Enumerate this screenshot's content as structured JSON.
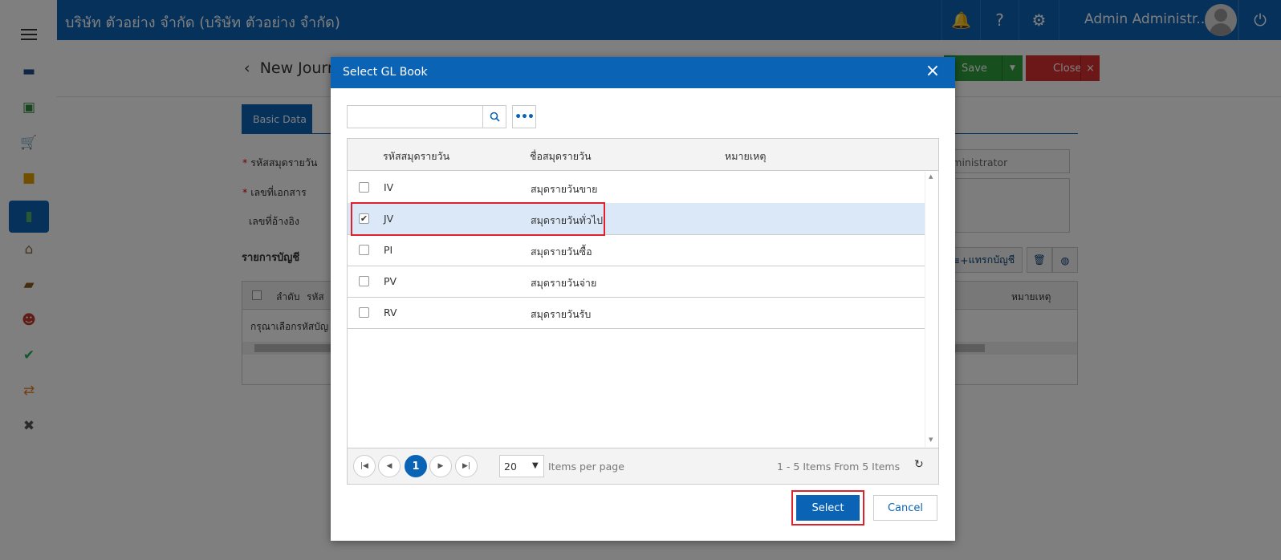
{
  "topbar": {
    "company": "บริษัท ตัวอย่าง จำกัด (บริษัท ตัวอย่าง จำกัด)",
    "user": "Admin Administr..."
  },
  "page": {
    "title": "New Journ",
    "save_label": "Save",
    "close_label": "Close",
    "close_x": "×",
    "tab_basic": "Basic Data",
    "label_journal_code": "รหัสสมุดรายวัน",
    "label_doc_no": "เลขที่เอกสาร",
    "label_ref_no": "เลขที่อ้างอิง",
    "req_mark": "*",
    "creator_value": "Administrator",
    "section_accounts": "รายการบัญชี",
    "insert_account_label": "แทรกบัญชี",
    "grid_col_seq": "ลำดับ",
    "grid_col_code": "รหัส",
    "grid_col_note": "หมายเหตุ",
    "grid_empty": "กรุณาเลือกรหัสบัญ"
  },
  "dialog": {
    "title": "Select GL Book",
    "search": {
      "value": "",
      "placeholder": ""
    },
    "columns": {
      "code": "รหัสสมุดรายวัน",
      "name": "ชื่อสมุดรายวัน",
      "note": "หมายเหตุ"
    },
    "rows": [
      {
        "code": "IV",
        "name": "สมุดรายวันขาย",
        "checked": false
      },
      {
        "code": "JV",
        "name": "สมุดรายวันทั่วไป",
        "checked": true
      },
      {
        "code": "PI",
        "name": "สมุดรายวันซื้อ",
        "checked": false
      },
      {
        "code": "PV",
        "name": "สมุดรายวันจ่าย",
        "checked": false
      },
      {
        "code": "RV",
        "name": "สมุดรายวันรับ",
        "checked": false
      }
    ],
    "pager": {
      "current_page": "1",
      "page_size": "20",
      "items_per_page_label": "Items per page",
      "info": "1 - 5 Items From 5 Items"
    },
    "select_label": "Select",
    "cancel_label": "Cancel"
  },
  "colors": {
    "primary": "#0b63b6",
    "save": "#2e9e3e",
    "close": "#d93131",
    "highlight": "#e0202a",
    "selected_row": "#dbe8f7"
  },
  "icons": {
    "sidebar": [
      "menu-icon",
      "dashboard-icon",
      "money-icon",
      "cart-icon",
      "box-icon",
      "book-icon",
      "bank-icon",
      "wallet-icon",
      "people-icon",
      "check-circle-icon",
      "transfer-icon",
      "tools-icon"
    ],
    "topbar": [
      "bell-icon",
      "help-icon",
      "gear-icon",
      "avatar",
      "power-icon"
    ]
  }
}
